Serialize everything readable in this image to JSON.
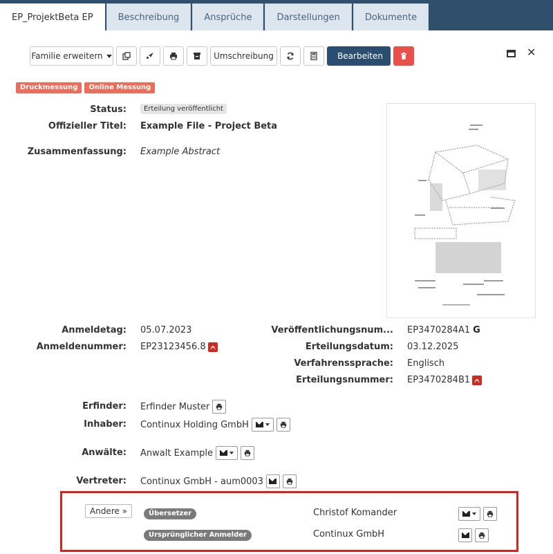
{
  "tabs": [
    {
      "label": "EP_ProjektBeta EP",
      "active": true
    },
    {
      "label": "Beschreibung",
      "active": false
    },
    {
      "label": "Ansprüche",
      "active": false
    },
    {
      "label": "Darstellungen",
      "active": false
    },
    {
      "label": "Dokumente",
      "active": false
    }
  ],
  "toolbar": {
    "familie_label": "Familie erweitern",
    "umschreibung_label": "Umschreibung",
    "bearbeiten_label": "Bearbeiten"
  },
  "tags": [
    "Druckmessung",
    "Online Messung"
  ],
  "fields": {
    "status_label": "Status:",
    "status_value": "Erteilung veröffentlicht",
    "titel_label": "Offizieller Titel:",
    "titel_value": "Example File - Project Beta",
    "zusammenfassung_label": "Zusammenfassung:",
    "zusammenfassung_value": "Example Abstract",
    "anmeldetag_label": "Anmeldetag:",
    "anmeldetag_value": "05.07.2023",
    "anmeldenummer_label": "Anmeldenummer:",
    "anmeldenummer_value": "EP23123456.8",
    "veroeff_label": "Veröffentlichungsnum...",
    "veroeff_value": "EP3470284A1",
    "erteilungsdatum_label": "Erteilungsdatum:",
    "erteilungsdatum_value": "03.12.2025",
    "verfahrenssprache_label": "Verfahrenssprache:",
    "verfahrenssprache_value": "Englisch",
    "erteilungsnummer_label": "Erteilungsnummer:",
    "erteilungsnummer_value": "EP3470284B1",
    "erfinder_label": "Erfinder:",
    "erfinder_value": "Erfinder Muster",
    "inhaber_label": "Inhaber:",
    "inhaber_value": "Continux Holding GmbH",
    "anwaelte_label": "Anwälte:",
    "anwaelte_value": "Anwalt Example",
    "vertreter_label": "Vertreter:",
    "vertreter_value": "Continux GmbH - aum0003"
  },
  "andere": {
    "button_label": "Andere »",
    "rows": [
      {
        "role": "Übersetzer",
        "name": "Christof Komander"
      },
      {
        "role": "Ursprünglicher Anmelder",
        "name": "Continux GmbH"
      }
    ]
  },
  "colors": {
    "header_bg": "#2f4f6d",
    "primary": "#2a4d70",
    "danger": "#e8514a",
    "tag": "#ee6c5a",
    "highlight": "#d9221e"
  }
}
